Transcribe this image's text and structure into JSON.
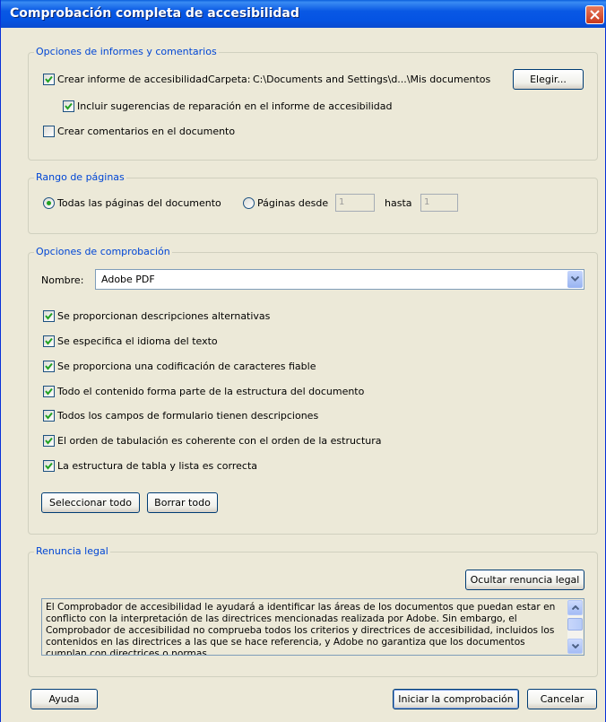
{
  "window": {
    "title": "Comprobación completa de accesibilidad"
  },
  "report_options": {
    "legend": "Opciones de informes y comentarios",
    "create_report": {
      "label": "Crear informe de accesibilidad",
      "checked": true
    },
    "folder_label": "Carpeta:",
    "folder_path": "C:\\Documents and Settings\\d...\\Mis documentos",
    "choose_button": "Elegir...",
    "include_suggestions": {
      "label": "Incluir sugerencias de reparación en el informe de accesibilidad",
      "checked": true
    },
    "create_comments": {
      "label": "Crear comentarios en el documento",
      "checked": false
    }
  },
  "page_range": {
    "legend": "Rango de páginas",
    "all_pages": {
      "label": "Todas las páginas del documento",
      "selected": true
    },
    "pages_from": {
      "label": "Páginas desde",
      "selected": false
    },
    "from_value": "1",
    "to_label": "hasta",
    "to_value": "1"
  },
  "check_options": {
    "legend": "Opciones de comprobación",
    "name_label": "Nombre:",
    "name_value": "Adobe PDF",
    "items": [
      {
        "label": "Se proporcionan descripciones alternativas",
        "checked": true
      },
      {
        "label": "Se especifica el idioma del texto",
        "checked": true
      },
      {
        "label": "Se proporciona una codificación de caracteres fiable",
        "checked": true
      },
      {
        "label": "Todo el contenido forma parte de la estructura del documento",
        "checked": true
      },
      {
        "label": "Todos los campos de formulario tienen descripciones",
        "checked": true
      },
      {
        "label": "El orden de tabulación es coherente con el orden de la estructura",
        "checked": true
      },
      {
        "label": "La estructura de tabla y lista es correcta",
        "checked": true
      }
    ],
    "select_all": "Seleccionar todo",
    "clear_all": "Borrar todo"
  },
  "legal": {
    "legend": "Renuncia legal",
    "hide_button": "Ocultar renuncia legal",
    "text": "El Comprobador de accesibilidad le ayudará a identificar las áreas de los documentos que puedan estar en conflicto con la interpretación de las directrices mencionadas realizada por Adobe. Sin embargo, el Comprobador de accesibilidad no comprueba todos los criterios y directrices de accesibilidad, incluidos los contenidos en las directrices a las que se hace referencia, y Adobe no garantiza que los documentos cumplan con directrices o normas."
  },
  "footer": {
    "help": "Ayuda",
    "start": "Iniciar la comprobación",
    "cancel": "Cancelar"
  },
  "colors": {
    "titlebar": "#0554E3",
    "dialog_bg": "#ECE9D8",
    "legend_text": "#0046D5",
    "check_green": "#21A121",
    "close_red": "#C8381C"
  }
}
